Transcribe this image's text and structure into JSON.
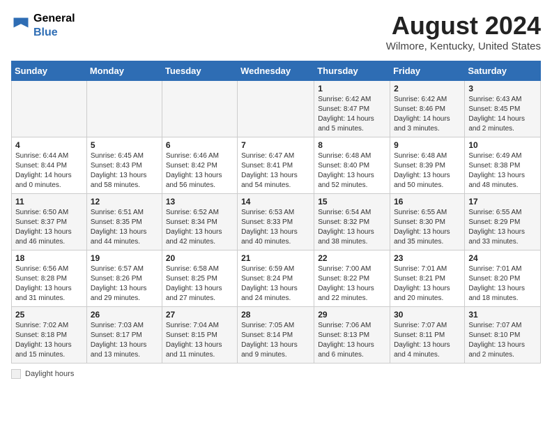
{
  "header": {
    "logo_general": "General",
    "logo_blue": "Blue",
    "title": "August 2024",
    "location": "Wilmore, Kentucky, United States"
  },
  "calendar": {
    "days_of_week": [
      "Sunday",
      "Monday",
      "Tuesday",
      "Wednesday",
      "Thursday",
      "Friday",
      "Saturday"
    ],
    "weeks": [
      [
        {
          "day": "",
          "info": ""
        },
        {
          "day": "",
          "info": ""
        },
        {
          "day": "",
          "info": ""
        },
        {
          "day": "",
          "info": ""
        },
        {
          "day": "1",
          "info": "Sunrise: 6:42 AM\nSunset: 8:47 PM\nDaylight: 14 hours\nand 5 minutes."
        },
        {
          "day": "2",
          "info": "Sunrise: 6:42 AM\nSunset: 8:46 PM\nDaylight: 14 hours\nand 3 minutes."
        },
        {
          "day": "3",
          "info": "Sunrise: 6:43 AM\nSunset: 8:45 PM\nDaylight: 14 hours\nand 2 minutes."
        }
      ],
      [
        {
          "day": "4",
          "info": "Sunrise: 6:44 AM\nSunset: 8:44 PM\nDaylight: 14 hours\nand 0 minutes."
        },
        {
          "day": "5",
          "info": "Sunrise: 6:45 AM\nSunset: 8:43 PM\nDaylight: 13 hours\nand 58 minutes."
        },
        {
          "day": "6",
          "info": "Sunrise: 6:46 AM\nSunset: 8:42 PM\nDaylight: 13 hours\nand 56 minutes."
        },
        {
          "day": "7",
          "info": "Sunrise: 6:47 AM\nSunset: 8:41 PM\nDaylight: 13 hours\nand 54 minutes."
        },
        {
          "day": "8",
          "info": "Sunrise: 6:48 AM\nSunset: 8:40 PM\nDaylight: 13 hours\nand 52 minutes."
        },
        {
          "day": "9",
          "info": "Sunrise: 6:48 AM\nSunset: 8:39 PM\nDaylight: 13 hours\nand 50 minutes."
        },
        {
          "day": "10",
          "info": "Sunrise: 6:49 AM\nSunset: 8:38 PM\nDaylight: 13 hours\nand 48 minutes."
        }
      ],
      [
        {
          "day": "11",
          "info": "Sunrise: 6:50 AM\nSunset: 8:37 PM\nDaylight: 13 hours\nand 46 minutes."
        },
        {
          "day": "12",
          "info": "Sunrise: 6:51 AM\nSunset: 8:35 PM\nDaylight: 13 hours\nand 44 minutes."
        },
        {
          "day": "13",
          "info": "Sunrise: 6:52 AM\nSunset: 8:34 PM\nDaylight: 13 hours\nand 42 minutes."
        },
        {
          "day": "14",
          "info": "Sunrise: 6:53 AM\nSunset: 8:33 PM\nDaylight: 13 hours\nand 40 minutes."
        },
        {
          "day": "15",
          "info": "Sunrise: 6:54 AM\nSunset: 8:32 PM\nDaylight: 13 hours\nand 38 minutes."
        },
        {
          "day": "16",
          "info": "Sunrise: 6:55 AM\nSunset: 8:30 PM\nDaylight: 13 hours\nand 35 minutes."
        },
        {
          "day": "17",
          "info": "Sunrise: 6:55 AM\nSunset: 8:29 PM\nDaylight: 13 hours\nand 33 minutes."
        }
      ],
      [
        {
          "day": "18",
          "info": "Sunrise: 6:56 AM\nSunset: 8:28 PM\nDaylight: 13 hours\nand 31 minutes."
        },
        {
          "day": "19",
          "info": "Sunrise: 6:57 AM\nSunset: 8:26 PM\nDaylight: 13 hours\nand 29 minutes."
        },
        {
          "day": "20",
          "info": "Sunrise: 6:58 AM\nSunset: 8:25 PM\nDaylight: 13 hours\nand 27 minutes."
        },
        {
          "day": "21",
          "info": "Sunrise: 6:59 AM\nSunset: 8:24 PM\nDaylight: 13 hours\nand 24 minutes."
        },
        {
          "day": "22",
          "info": "Sunrise: 7:00 AM\nSunset: 8:22 PM\nDaylight: 13 hours\nand 22 minutes."
        },
        {
          "day": "23",
          "info": "Sunrise: 7:01 AM\nSunset: 8:21 PM\nDaylight: 13 hours\nand 20 minutes."
        },
        {
          "day": "24",
          "info": "Sunrise: 7:01 AM\nSunset: 8:20 PM\nDaylight: 13 hours\nand 18 minutes."
        }
      ],
      [
        {
          "day": "25",
          "info": "Sunrise: 7:02 AM\nSunset: 8:18 PM\nDaylight: 13 hours\nand 15 minutes."
        },
        {
          "day": "26",
          "info": "Sunrise: 7:03 AM\nSunset: 8:17 PM\nDaylight: 13 hours\nand 13 minutes."
        },
        {
          "day": "27",
          "info": "Sunrise: 7:04 AM\nSunset: 8:15 PM\nDaylight: 13 hours\nand 11 minutes."
        },
        {
          "day": "28",
          "info": "Sunrise: 7:05 AM\nSunset: 8:14 PM\nDaylight: 13 hours\nand 9 minutes."
        },
        {
          "day": "29",
          "info": "Sunrise: 7:06 AM\nSunset: 8:13 PM\nDaylight: 13 hours\nand 6 minutes."
        },
        {
          "day": "30",
          "info": "Sunrise: 7:07 AM\nSunset: 8:11 PM\nDaylight: 13 hours\nand 4 minutes."
        },
        {
          "day": "31",
          "info": "Sunrise: 7:07 AM\nSunset: 8:10 PM\nDaylight: 13 hours\nand 2 minutes."
        }
      ]
    ]
  },
  "legend": {
    "label": "Daylight hours"
  }
}
